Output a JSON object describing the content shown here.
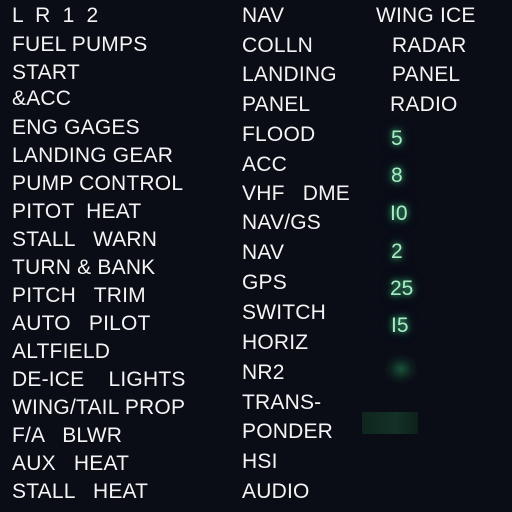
{
  "left_column": [
    "L  R  1  2",
    "FUEL PUMPS",
    "START",
    "&ACC",
    "ENG GAGES",
    "LANDING GEAR",
    "PUMP CONTROL",
    "PITOT  HEAT",
    "STALL   WARN",
    "TURN & BANK",
    "PITCH   TRIM",
    "AUTO   PILOT",
    "ALTFIELD",
    "DE-ICE    LIGHTS",
    "WING/TAIL PROP",
    "F/A   BLWR",
    "AUX   HEAT",
    "STALL   HEAT"
  ],
  "middle_column": [
    "NAV",
    "COLLN",
    "LANDING",
    "PANEL",
    "FLOOD",
    "ACC",
    "VHF   DME",
    "NAV/GS",
    "NAV",
    "GPS",
    "SWITCH",
    "HORIZ",
    "NR2",
    "TRANS-",
    "PONDER",
    "HSI",
    "AUDIO"
  ],
  "right_column": [
    "WING ICE",
    "RADAR",
    "PANEL",
    "RADIO"
  ],
  "breaker_ratings": [
    "5",
    "8",
    "I0",
    "2",
    "25",
    "I5"
  ],
  "colors": {
    "background": "#0a0c16",
    "label": "#f4f4f4",
    "rating_glow": "#a8ecc4"
  }
}
